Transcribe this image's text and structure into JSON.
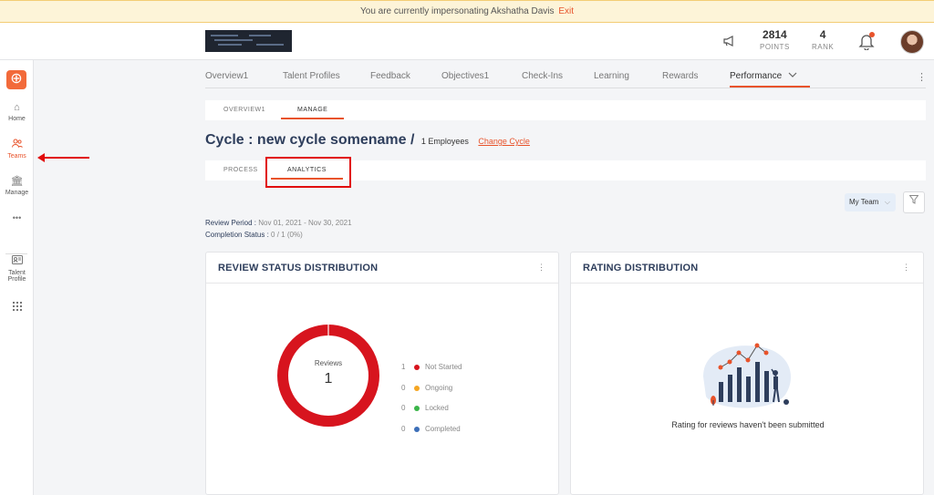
{
  "banner": {
    "text": "You are currently impersonating Akshatha Davis",
    "exit_label": "Exit"
  },
  "topbar": {
    "points_value": "2814",
    "points_label": "POINTS",
    "rank_value": "4",
    "rank_label": "RANK"
  },
  "sidebar": {
    "add_icon": "plus-icon",
    "items": [
      {
        "label": "Home",
        "icon": "home-icon"
      },
      {
        "label": "Teams",
        "icon": "users-icon"
      },
      {
        "label": "Manage",
        "icon": "bank-icon"
      },
      {
        "label": "•••",
        "icon": "more-icon"
      },
      {
        "label": "Talent\nProfile",
        "icon": "id-card-icon"
      },
      {
        "label": "",
        "icon": "grid-icon"
      }
    ]
  },
  "tabs": [
    {
      "label": "Overview1"
    },
    {
      "label": "Talent Profiles"
    },
    {
      "label": "Feedback"
    },
    {
      "label": "Objectives1"
    },
    {
      "label": "Check-Ins"
    },
    {
      "label": "Learning"
    },
    {
      "label": "Rewards"
    },
    {
      "label": "Performance"
    }
  ],
  "subtabs": [
    {
      "label": "OVERVIEW1"
    },
    {
      "label": "MANAGE"
    }
  ],
  "cycle": {
    "title": "Cycle : new cycle somename /",
    "employees": "1 Employees",
    "change_label": "Change Cycle"
  },
  "ptabs": [
    {
      "label": "PROCESS"
    },
    {
      "label": "ANALYTICS"
    }
  ],
  "filters": {
    "team_selected": "My Team"
  },
  "meta": {
    "review_period_label": "Review Period :",
    "review_period_value": "Nov 01, 2021 - Nov 30, 2021",
    "completion_label": "Completion Status :",
    "completion_value": "0 / 1 (0%)"
  },
  "review_card": {
    "title": "REVIEW STATUS DISTRIBUTION",
    "center_label": "Reviews",
    "center_value": "1",
    "legend": [
      {
        "count": "1",
        "name": "Not Started",
        "color": "#d7141e"
      },
      {
        "count": "0",
        "name": "Ongoing",
        "color": "#f5a623"
      },
      {
        "count": "0",
        "name": "Locked",
        "color": "#3bb54a"
      },
      {
        "count": "0",
        "name": "Completed",
        "color": "#3d6fb8"
      }
    ]
  },
  "rating_card": {
    "title": "RATING DISTRIBUTION",
    "empty_text": "Rating for reviews haven't been submitted"
  },
  "colors": {
    "accent": "#e8532b",
    "navy": "#2e3e5c",
    "annotation_red": "#e10b0b"
  }
}
